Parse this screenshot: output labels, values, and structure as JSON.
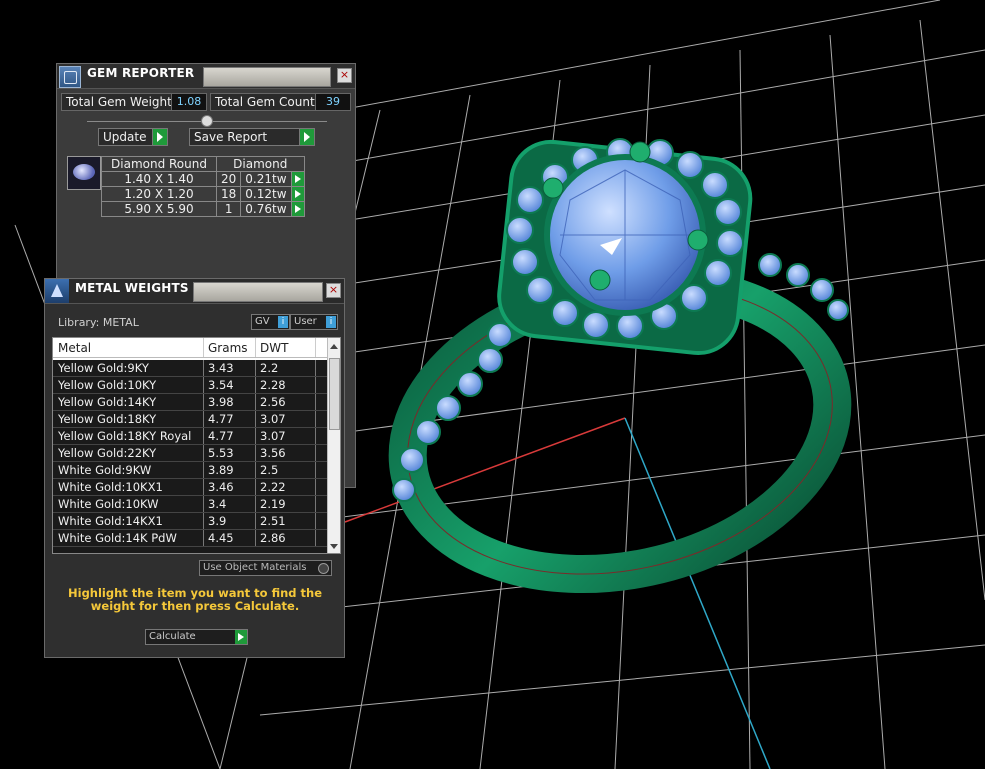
{
  "gem_reporter": {
    "title": "GEM REPORTER",
    "close": "×",
    "total_weight_label": "Total Gem Weight",
    "total_weight_value": "1.08",
    "total_count_label": "Total Gem Count",
    "total_count_value": "39",
    "update_label": "Update",
    "save_report_label": "Save Report",
    "table": {
      "headers": [
        "Diamond Round",
        "Diamond"
      ],
      "rows": [
        {
          "size": "1.40 X 1.40",
          "count": "20",
          "weight": "0.21tw"
        },
        {
          "size": "1.20 X 1.20",
          "count": "18",
          "weight": "0.12tw"
        },
        {
          "size": "5.90 X 5.90",
          "count": "1",
          "weight": "0.76tw"
        }
      ]
    }
  },
  "metal_weights": {
    "title": "METAL WEIGHTS",
    "close": "×",
    "library": "Library: METAL",
    "gv_label": "GV",
    "user_label": "User",
    "info_glyph": "i",
    "columns": [
      "Metal",
      "Grams",
      "DWT"
    ],
    "rows": [
      {
        "metal": "Yellow Gold:9KY",
        "grams": "3.43",
        "dwt": "2.2"
      },
      {
        "metal": "Yellow Gold:10KY",
        "grams": "3.54",
        "dwt": "2.28"
      },
      {
        "metal": "Yellow Gold:14KY",
        "grams": "3.98",
        "dwt": "2.56"
      },
      {
        "metal": "Yellow Gold:18KY",
        "grams": "4.77",
        "dwt": "3.07"
      },
      {
        "metal": "Yellow Gold:18KY Royal",
        "grams": "4.77",
        "dwt": "3.07"
      },
      {
        "metal": "Yellow Gold:22KY",
        "grams": "5.53",
        "dwt": "3.56"
      },
      {
        "metal": "White Gold:9KW",
        "grams": "3.89",
        "dwt": "2.5"
      },
      {
        "metal": "White Gold:10KX1",
        "grams": "3.46",
        "dwt": "2.22"
      },
      {
        "metal": "White Gold:10KW",
        "grams": "3.4",
        "dwt": "2.19"
      },
      {
        "metal": "White Gold:14KX1",
        "grams": "3.9",
        "dwt": "2.51"
      },
      {
        "metal": "White Gold:14K PdW",
        "grams": "4.45",
        "dwt": "2.86"
      }
    ],
    "use_object_materials": "Use Object Materials",
    "hint": "Highlight the item you want to find the weight for then press Calculate.",
    "calculate_label": "Calculate"
  },
  "colors": {
    "ring_green": "#0d7a52",
    "gem_blue": "#6f9de8",
    "accent_green": "#1f9a3a",
    "hint_yellow": "#f5c83a"
  }
}
